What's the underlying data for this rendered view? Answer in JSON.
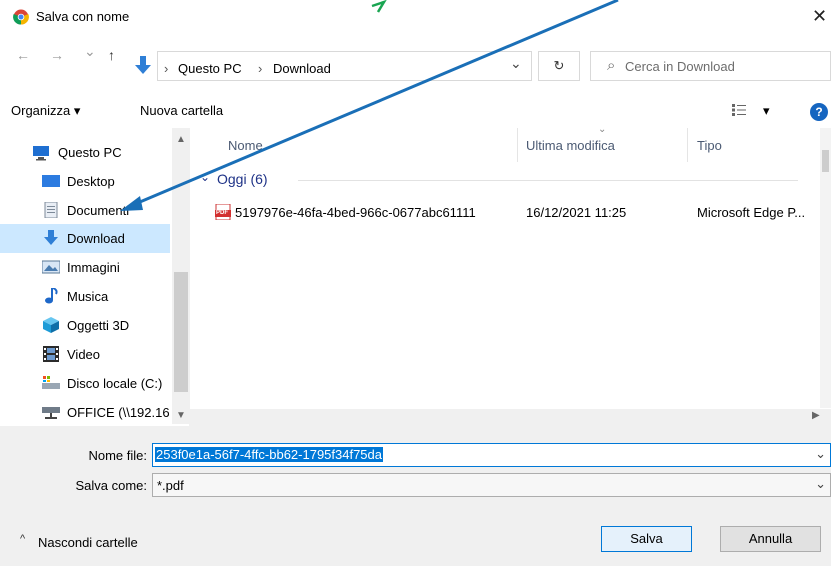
{
  "dialog": {
    "title": "Salva con nome",
    "close_symbol": "✕"
  },
  "address": {
    "back_symbol": "←",
    "forward_symbol": "→",
    "recent_symbol": "⌄",
    "up_symbol": "↑",
    "crumbs": [
      "Questo PC",
      "Download"
    ],
    "crumb_sep": "›",
    "dropdown_symbol": "⌄",
    "refresh_symbol": "↻",
    "search_placeholder": "Cerca in Download",
    "search_icon_symbol": "⌕"
  },
  "toolbar": {
    "organize_label": "Organizza ▾",
    "new_folder_label": "Nuova cartella",
    "view_symbol": "▾",
    "help_symbol": "?"
  },
  "nav": {
    "items": [
      {
        "label": "Questo PC"
      },
      {
        "label": "Desktop"
      },
      {
        "label": "Documenti"
      },
      {
        "label": "Download"
      },
      {
        "label": "Immagini"
      },
      {
        "label": "Musica"
      },
      {
        "label": "Oggetti 3D"
      },
      {
        "label": "Video"
      },
      {
        "label": "Disco locale (C:)"
      },
      {
        "label": "OFFICE (\\\\192.16"
      }
    ],
    "selected": "Download"
  },
  "files": {
    "columns": [
      "Nome",
      "Ultima modifica",
      "Tipo"
    ],
    "group_label": "Oggi (6)",
    "rows": [
      {
        "name": "5197976e-46fa-4bed-966c-0677abc61111",
        "modified": "16/12/2021 11:25",
        "type": "Microsoft Edge P..."
      }
    ],
    "pdf_badge": "PDF"
  },
  "form": {
    "filename_label": "Nome file:",
    "filename_value": "253f0e1a-56f7-4ffc-bb62-1795f34f75da",
    "savetype_label": "Salva come:",
    "savetype_value": "*.pdf",
    "hide_folders_label": "Nascondi cartelle",
    "hide_folders_symbol": "^",
    "save_label": "Salva",
    "cancel_label": "Annulla"
  },
  "colors": {
    "accent": "#0078d7",
    "selected_nav": "#cce8ff",
    "annotation_arrow": "#1a6fb7"
  }
}
